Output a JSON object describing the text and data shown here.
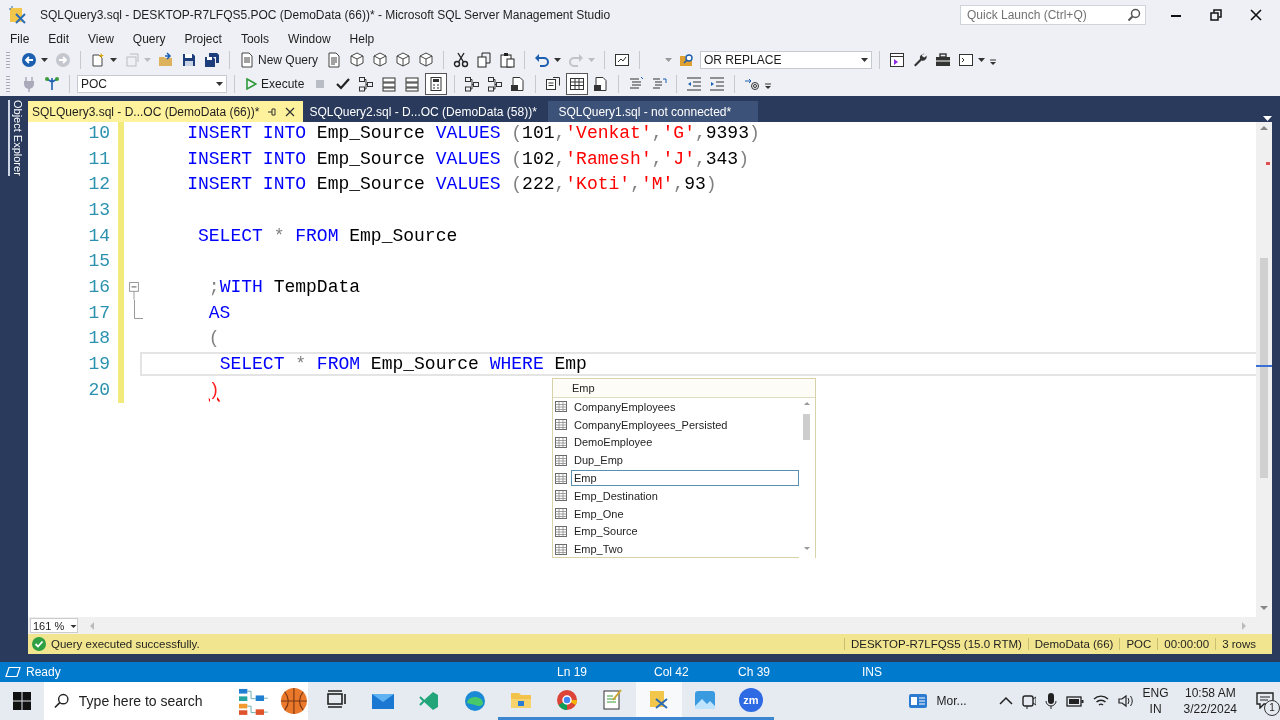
{
  "window": {
    "title": "SQLQuery3.sql - DESKTOP-R7LFQS5.POC (DemoData (66))* - Microsoft SQL Server Management Studio",
    "quick_launch": {
      "placeholder": "Quick Launch (Ctrl+Q)"
    }
  },
  "menu": [
    "File",
    "Edit",
    "View",
    "Query",
    "Project",
    "Tools",
    "Window",
    "Help"
  ],
  "toolbar": {
    "new_query": "New Query",
    "find_combo": "OR REPLACE",
    "database": "POC",
    "execute": "Execute",
    "toggles": [
      {
        "pressed": false
      },
      {
        "pressed": false
      },
      {
        "pressed": true
      },
      {
        "pressed": false
      },
      {
        "pressed": true
      },
      {
        "pressed": false
      }
    ]
  },
  "side_panel": {
    "label": "Object Explorer"
  },
  "tabs": [
    {
      "label": "SQLQuery3.sql - D...OC (DemoData (66))*",
      "selected": true,
      "hovered": false
    },
    {
      "label": "SQLQuery2.sql - D...OC (DemoData (58))*",
      "selected": false,
      "hovered": false
    },
    {
      "label": "SQLQuery1.sql - not connected*",
      "selected": false,
      "hovered": true
    }
  ],
  "editor": {
    "lines": [
      {
        "number": "10",
        "changed": true,
        "current": false,
        "tokens": [
          {
            "kind": "keyword",
            "t": "    INSERT INTO"
          },
          {
            "kind": "identifier",
            "t": " Emp_Source "
          },
          {
            "kind": "keyword",
            "t": "VALUES"
          },
          {
            "kind": "operator",
            "t": " ("
          },
          {
            "kind": "number",
            "t": "101"
          },
          {
            "kind": "operator",
            "t": ","
          },
          {
            "kind": "string",
            "t": "'Venkat'"
          },
          {
            "kind": "operator",
            "t": ","
          },
          {
            "kind": "string",
            "t": "'G'"
          },
          {
            "kind": "operator",
            "t": ","
          },
          {
            "kind": "number",
            "t": "9393"
          },
          {
            "kind": "operator",
            "t": ")"
          }
        ]
      },
      {
        "number": "11",
        "changed": true,
        "current": false,
        "tokens": [
          {
            "kind": "keyword",
            "t": "    INSERT INTO"
          },
          {
            "kind": "identifier",
            "t": " Emp_Source "
          },
          {
            "kind": "keyword",
            "t": "VALUES"
          },
          {
            "kind": "operator",
            "t": " ("
          },
          {
            "kind": "number",
            "t": "102"
          },
          {
            "kind": "operator",
            "t": ","
          },
          {
            "kind": "string",
            "t": "'Ramesh'"
          },
          {
            "kind": "operator",
            "t": ","
          },
          {
            "kind": "string",
            "t": "'J'"
          },
          {
            "kind": "operator",
            "t": ","
          },
          {
            "kind": "number",
            "t": "343"
          },
          {
            "kind": "operator",
            "t": ")"
          }
        ]
      },
      {
        "number": "12",
        "changed": true,
        "current": false,
        "tokens": [
          {
            "kind": "keyword",
            "t": "    INSERT INTO"
          },
          {
            "kind": "identifier",
            "t": " Emp_Source "
          },
          {
            "kind": "keyword",
            "t": "VALUES"
          },
          {
            "kind": "operator",
            "t": " ("
          },
          {
            "kind": "number",
            "t": "222"
          },
          {
            "kind": "operator",
            "t": ","
          },
          {
            "kind": "string",
            "t": "'Koti'"
          },
          {
            "kind": "operator",
            "t": ","
          },
          {
            "kind": "string",
            "t": "'M'"
          },
          {
            "kind": "operator",
            "t": ","
          },
          {
            "kind": "number",
            "t": "93"
          },
          {
            "kind": "operator",
            "t": ")"
          }
        ]
      },
      {
        "number": "13",
        "changed": true,
        "current": false
      },
      {
        "number": "14",
        "changed": true,
        "current": false,
        "tokens": [
          {
            "kind": "keyword",
            "t": "     SELECT"
          },
          {
            "kind": "operator",
            "t": " * "
          },
          {
            "kind": "keyword",
            "t": "FROM"
          },
          {
            "kind": "identifier",
            "t": " Emp_Source"
          }
        ]
      },
      {
        "number": "15",
        "changed": true,
        "current": false
      },
      {
        "number": "16",
        "changed": true,
        "current": false,
        "fold": {
          "kind": "start"
        },
        "tokens": [
          {
            "kind": "operator",
            "t": "      ;"
          },
          {
            "kind": "keyword",
            "t": "WITH"
          },
          {
            "kind": "identifier",
            "t": " TempData"
          }
        ]
      },
      {
        "number": "17",
        "changed": true,
        "current": false,
        "fold": {
          "kind": "end"
        },
        "tokens": [
          {
            "kind": "keyword",
            "t": "      AS"
          }
        ]
      },
      {
        "number": "18",
        "changed": true,
        "current": false,
        "tokens": [
          {
            "kind": "operator",
            "t": "      ("
          }
        ]
      },
      {
        "number": "19",
        "changed": true,
        "current": true,
        "tokens": [
          {
            "kind": "keyword",
            "t": "       SELECT"
          },
          {
            "kind": "operator",
            "t": " * "
          },
          {
            "kind": "keyword",
            "t": "FROM"
          },
          {
            "kind": "identifier",
            "t": " Emp_Source "
          },
          {
            "kind": "keyword",
            "t": "WHERE"
          },
          {
            "kind": "identifier",
            "t": " Emp"
          }
        ]
      },
      {
        "number": "20",
        "changed": true,
        "current": false,
        "tokens": [
          {
            "kind": "error",
            "t": "      )"
          }
        ]
      }
    ],
    "completion": {
      "filter": "Emp",
      "items": [
        {
          "label": "CompanyEmployees",
          "selected": false
        },
        {
          "label": "CompanyEmployees_Persisted",
          "selected": false
        },
        {
          "label": "DemoEmployee",
          "selected": false
        },
        {
          "label": "Dup_Emp",
          "selected": false
        },
        {
          "label": "Emp",
          "selected": true
        },
        {
          "label": "Emp_Destination",
          "selected": false
        },
        {
          "label": "Emp_One",
          "selected": false
        },
        {
          "label": "Emp_Source",
          "selected": false
        },
        {
          "label": "Emp_Two",
          "selected": false
        }
      ]
    }
  },
  "zoom": "161 %",
  "query_status": {
    "message": "Query executed successfully.",
    "segments": [
      "DESKTOP-R7LFQS5 (15.0 RTM)",
      "DemoData (66)",
      "POC",
      "00:00:00",
      "3 rows"
    ]
  },
  "status_bar": {
    "state": "Ready",
    "ln": "Ln 19",
    "col": "Col 42",
    "ch": "Ch 39",
    "mode": "INS"
  },
  "taskbar": {
    "search_placeholder": "Type here to search",
    "apps": [
      {
        "kind": "task-view",
        "running": false
      },
      {
        "kind": "mail",
        "running": false
      },
      {
        "kind": "code",
        "running": false
      },
      {
        "kind": "edge",
        "running": false
      },
      {
        "kind": "files",
        "running": true
      },
      {
        "kind": "chrome",
        "running": true
      },
      {
        "kind": "notepad",
        "running": true
      },
      {
        "kind": "ssms",
        "running": true,
        "active": true
      },
      {
        "kind": "photos",
        "running": true
      },
      {
        "kind": "zoom",
        "running": true,
        "label": "zm"
      }
    ],
    "tray": {
      "widget": "Mor...",
      "language": "ENG",
      "region": "IN",
      "time": "10:58 AM",
      "date": "3/22/2024",
      "notifications": "1"
    }
  }
}
